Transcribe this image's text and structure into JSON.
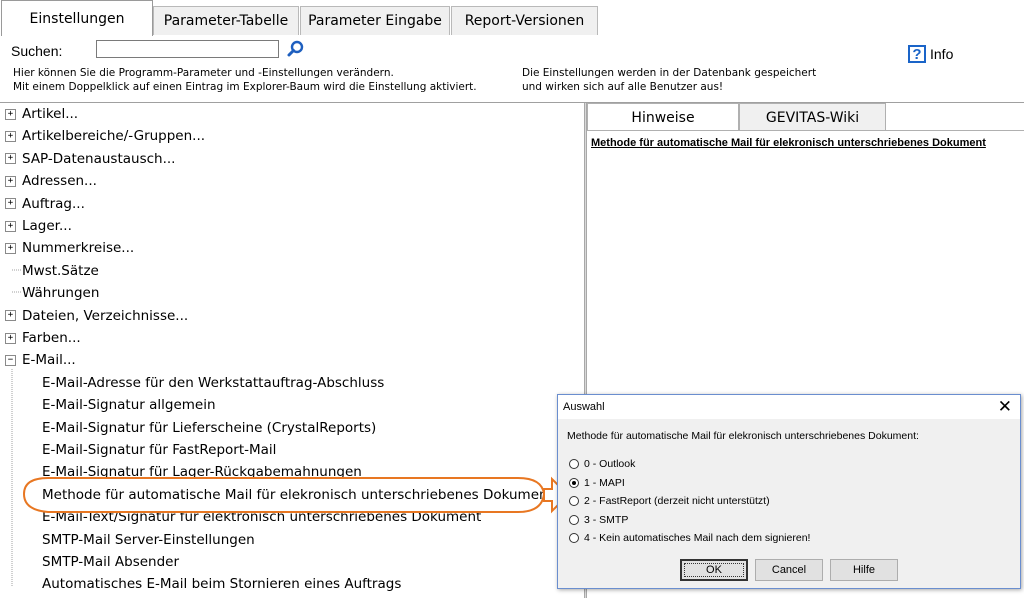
{
  "tabs": [
    {
      "label": "Einstellungen",
      "active": true
    },
    {
      "label": "Parameter-Tabelle",
      "active": false
    },
    {
      "label": "Parameter Eingabe",
      "active": false
    },
    {
      "label": "Report-Versionen",
      "active": false
    }
  ],
  "search": {
    "label": "Suchen:",
    "value": "",
    "placeholder": ""
  },
  "hints": {
    "left_line1": "Hier können Sie die Programm-Parameter und -Einstellungen verändern.",
    "left_line2": "Mit einem Doppelklick auf einen Eintrag im Explorer-Baum wird die Einstellung  aktiviert.",
    "right_line1": "Die Einstellungen werden in der Datenbank gespeichert",
    "right_line2": "und wirken sich auf alle Benutzer aus!"
  },
  "info": {
    "label": "Info",
    "icon": "question-icon"
  },
  "tree": {
    "items": [
      {
        "label": "Artikel...",
        "expander": "+"
      },
      {
        "label": "Artikelbereiche/-Gruppen...",
        "expander": "+"
      },
      {
        "label": "SAP-Datenaustausch...",
        "expander": "+"
      },
      {
        "label": "Adressen...",
        "expander": "+"
      },
      {
        "label": "Auftrag...",
        "expander": "+"
      },
      {
        "label": "Lager...",
        "expander": "+"
      },
      {
        "label": "Nummerkreise...",
        "expander": "+"
      },
      {
        "label": "Mwst.Sätze",
        "expander": ""
      },
      {
        "label": "Währungen",
        "expander": ""
      },
      {
        "label": "Dateien, Verzeichnisse...",
        "expander": "+"
      },
      {
        "label": "Farben...",
        "expander": "+"
      },
      {
        "label": "E-Mail...",
        "expander": "−"
      }
    ],
    "email_children": [
      "E-Mail-Adresse für den Werkstattauftrag-Abschluss",
      "E-Mail-Signatur allgemein",
      "E-Mail-Signatur für Lieferscheine (CrystalReports)",
      "E-Mail-Signatur für FastReport-Mail",
      "E-Mail-Signatur für Lager-Rückgabemahnungen",
      "Methode für automatische Mail für elekronisch unterschriebenes Dokument",
      "E-Mail-Text/Signatur für elektronisch unterschriebenes Dokument",
      "SMTP-Mail Server-Einstellungen",
      "SMTP-Mail Absender",
      "Automatisches E-Mail beim Stornieren eines Auftrags"
    ]
  },
  "right_panel": {
    "tabs": [
      {
        "label": "Hinweise",
        "active": true
      },
      {
        "label": "GEVITAS-Wiki",
        "active": false
      }
    ],
    "title": "Methode für automatische Mail für elekronisch unterschriebenes Dokument"
  },
  "dialog": {
    "title": "Auswahl",
    "close_glyph": "✕",
    "question": "Methode für automatische Mail für elekronisch unterschriebenes Dokument:",
    "options": [
      {
        "label": "0 - Outlook",
        "selected": false
      },
      {
        "label": "1 - MAPI",
        "selected": true
      },
      {
        "label": "2 - FastReport (derzeit nicht unterstützt)",
        "selected": false
      },
      {
        "label": "3 - SMTP",
        "selected": false
      },
      {
        "label": "4 - Kein automatisches Mail nach dem signieren!",
        "selected": false
      }
    ],
    "buttons": {
      "ok": "OK",
      "cancel": "Cancel",
      "help": "Hilfe"
    }
  },
  "colors": {
    "highlight": "#e87722",
    "info_icon": "#1a64c8",
    "search_icon": "#1e5fbf"
  }
}
